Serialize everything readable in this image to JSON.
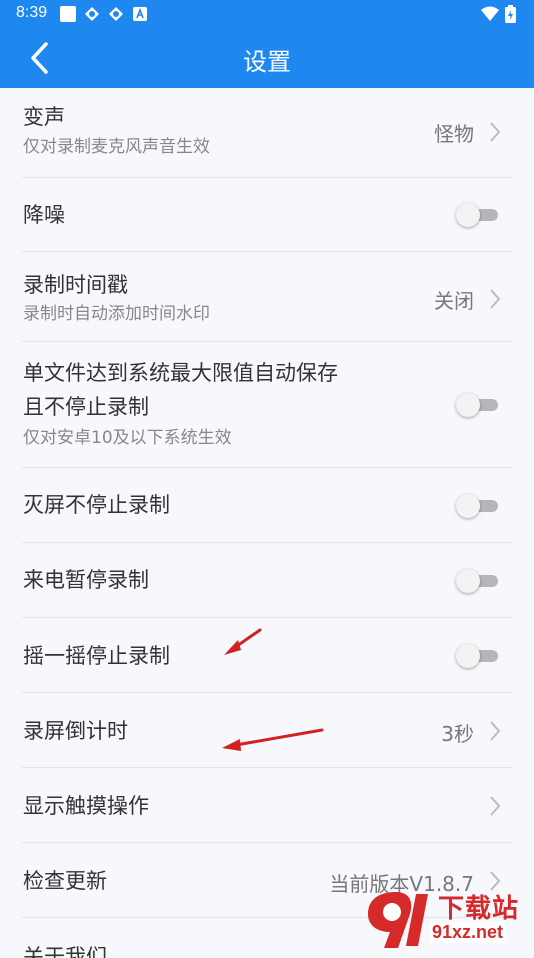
{
  "status": {
    "time": "8:39"
  },
  "header": {
    "title": "设置"
  },
  "settings": [
    {
      "title": "变声",
      "subtitle": "仅对录制麦克风声音生效",
      "value": "怪物",
      "control": "chevron"
    },
    {
      "title": "降噪",
      "control": "toggle",
      "on": false
    },
    {
      "title": "录制时间戳",
      "subtitle": "录制时自动添加时间水印",
      "value": "关闭",
      "control": "chevron"
    },
    {
      "title_line1": "单文件达到系统最大限值自动保存",
      "title_line2": "且不停止录制",
      "subtitle": "仅对安卓10及以下系统生效",
      "control": "toggle",
      "on": false
    },
    {
      "title": "灭屏不停止录制",
      "control": "toggle",
      "on": false
    },
    {
      "title": "来电暂停录制",
      "control": "toggle",
      "on": false
    },
    {
      "title": "摇一摇停止录制",
      "control": "toggle",
      "on": false
    },
    {
      "title": "录屏倒计时",
      "value": "3秒",
      "control": "chevron"
    },
    {
      "title": "显示触摸操作",
      "control": "chevron"
    },
    {
      "title": "检查更新",
      "value": "当前版本V1.8.7",
      "control": "chevron"
    },
    {
      "title": "关于我们"
    }
  ],
  "watermark": {
    "brand": "下载站",
    "domain": "91xz.net"
  },
  "colors": {
    "header": "#1e88f0",
    "annotation_arrow": "#d42020"
  }
}
